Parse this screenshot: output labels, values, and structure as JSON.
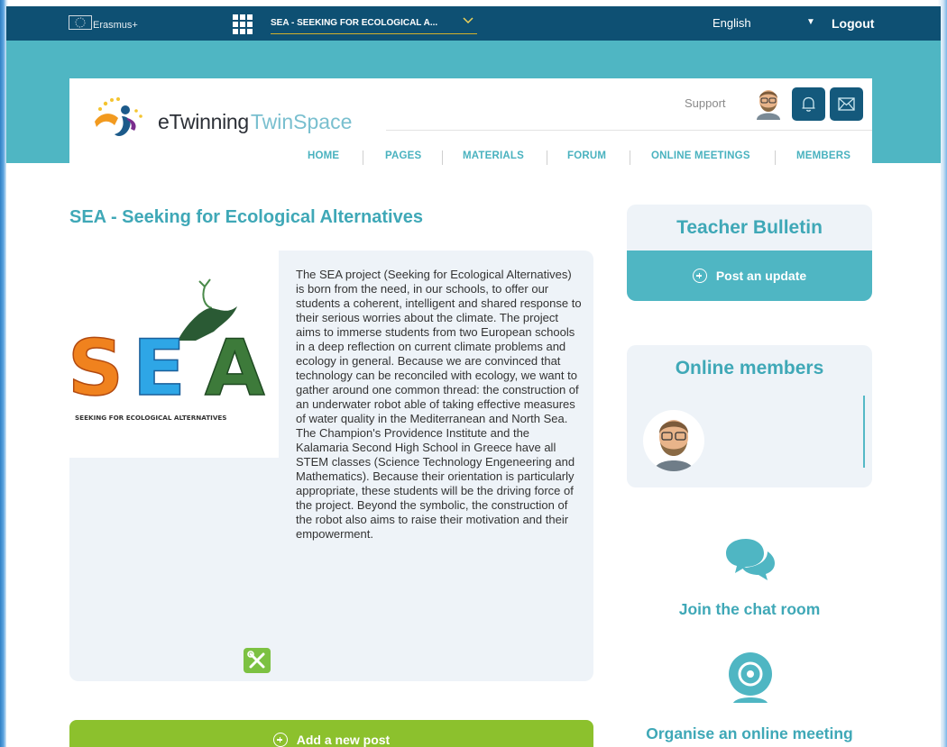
{
  "topbar": {
    "program": "Erasmus+",
    "space_name": "SEA - SEEKING FOR ECOLOGICAL A...",
    "language": "English",
    "logout": "Logout"
  },
  "header": {
    "logo_part1": "eTwinning",
    "logo_part2": "TwinSpace",
    "support": "Support",
    "nav": [
      "HOME",
      "PAGES",
      "MATERIALS",
      "FORUM",
      "ONLINE MEETINGS",
      "MEMBERS"
    ]
  },
  "main": {
    "title": "SEA - Seeking for Ecological Alternatives",
    "image_caption": "SEEKING FOR ECOLOGICAL ALTERNATIVES",
    "image_letters": [
      "S",
      "E",
      "A"
    ],
    "description": "The SEA project (Seeking for Ecological Alternatives) is born from the need, in our schools, to offer our students a coherent, intelligent and shared response to their serious worries about the climate. The project aims to immerse students from two European schools in a deep reflection on current climate problems and ecology in general. Because we are convinced that technology can be reconciled with ecology, we want to gather around one common thread: the construction of an underwater robot able of taking effective measures of water quality in the Mediterranean and North Sea. The Champion's Providence Institute and the Kalamaria Second High School in Greece have all STEM classes (Science Technology Engeneering and Mathematics). Because their orientation is particularly appropriate, these students will be the driving force of the project. Beyond the symbolic, the construction of the robot also aims to raise their motivation and their empowerment.",
    "add_post": "Add a new post"
  },
  "sidebar": {
    "bulletin_title": "Teacher Bulletin",
    "post_update": "Post an update",
    "online_title": "Online members",
    "chat": "Join the chat room",
    "meeting": "Organise an online meeting"
  },
  "colors": {
    "topbar": "#0e5073",
    "teal": "#4fb6c3",
    "title_teal": "#3fa8b7",
    "green": "#8cc12d",
    "card_bg": "#eef3f8"
  },
  "icons": [
    "eu-flag-icon",
    "apps-grid-icon",
    "chevron-down-icon",
    "caret-down-icon",
    "bell-icon",
    "mail-icon",
    "tools-icon",
    "plus-circle-icon",
    "chat-bubbles-icon",
    "webcam-icon"
  ]
}
